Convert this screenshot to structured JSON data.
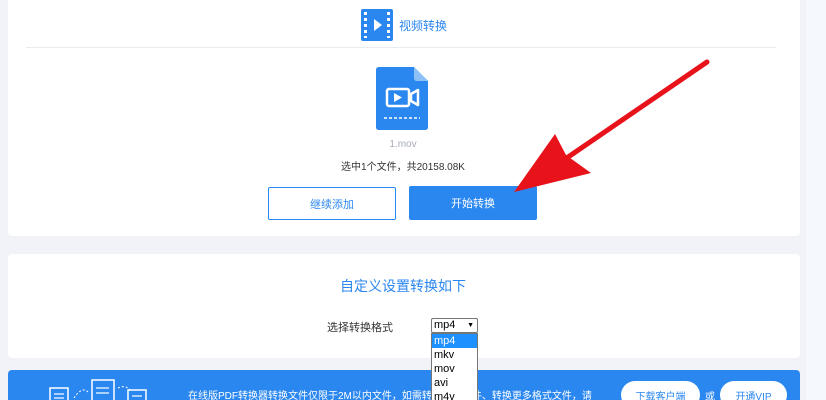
{
  "tool": {
    "title": "视频转换",
    "icon": "video-icon"
  },
  "file": {
    "name": "1.mov",
    "info": "选中1个文件，共20158.08K",
    "icon": "video-file-icon"
  },
  "buttons": {
    "add": "继续添加",
    "start": "开始转换"
  },
  "settings": {
    "title": "自定义设置转换如下",
    "format_label": "选择转换格式",
    "format_value": "mp4",
    "options": [
      "mp4",
      "mkv",
      "mov",
      "avi",
      "m4v"
    ]
  },
  "banner": {
    "text": "在线版PDF转换器转换文件仅限于2M以内文件，如需转换更大文件、转换更多格式文件，请",
    "download": "下载客户端",
    "or": "或",
    "vip": "开通VIP"
  },
  "colors": {
    "accent": "#2b87f0",
    "arrow": "#e8121b",
    "selected_option": "#1e90ff"
  }
}
